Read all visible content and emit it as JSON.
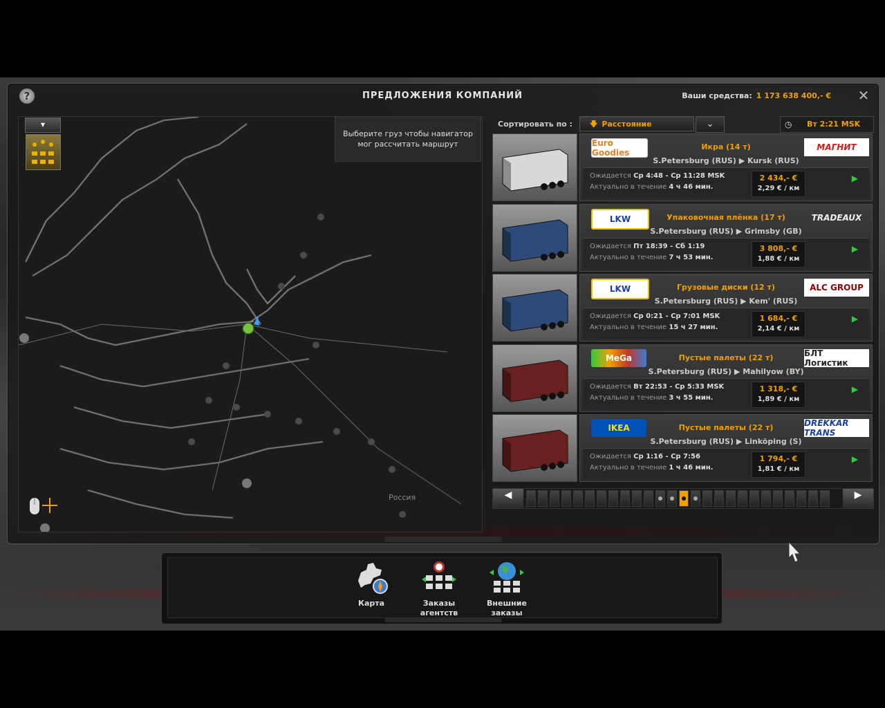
{
  "window": {
    "title": "ПРЕДЛОЖЕНИЯ КОМПАНИЙ",
    "funds_label": "Ваши средства:",
    "funds_value": "1 173 638 400,- €",
    "help_icon": "question-icon",
    "close_icon": "close-icon"
  },
  "map": {
    "tooltip_line1": "Выберите груз чтобы навигатор",
    "tooltip_line2": "мог рассчитать маршрут",
    "region_label": "Россия"
  },
  "sort": {
    "label": "Сортировать по :",
    "selected": "Расстояние",
    "game_time": "Вт 2:21 MSK"
  },
  "jobs": [
    {
      "company_left": "Euro Goodies",
      "company_right": "МАГНИТ",
      "cargo": "Икра (14 т)",
      "from": "S.Petersburg (RUS)",
      "to": "Kursk (RUS)",
      "expected_label": "Ожидается",
      "expected": "Ср 4:48 - Ср 11:28 MSK",
      "valid_label": "Актуально в течение",
      "valid": "4 ч 46 мин.",
      "price": "2 434,- €",
      "rate": "2,29 € / км",
      "trailer_color": "#d8d8d8"
    },
    {
      "company_left": "LKW",
      "company_right": "TRADEAUX",
      "cargo": "Упаковочная плёнка (17 т)",
      "from": "S.Petersburg (RUS)",
      "to": "Grimsby (GB)",
      "expected_label": "Ожидается",
      "expected": "Пт 18:39 - Сб 1:19",
      "valid_label": "Актуально в течение",
      "valid": "7 ч 53 мин.",
      "price": "3 808,- €",
      "rate": "1,88 € / км",
      "trailer_color": "#2d4a78"
    },
    {
      "company_left": "LKW",
      "company_right": "ALC GROUP",
      "cargo": "Грузовые диски (12 т)",
      "from": "S.Petersburg (RUS)",
      "to": "Kem' (RUS)",
      "expected_label": "Ожидается",
      "expected": "Ср 0:21 - Ср 7:01 MSK",
      "valid_label": "Актуально в течение",
      "valid": "15 ч 27 мин.",
      "price": "1 684,- €",
      "rate": "2,14 € / км",
      "trailer_color": "#2d4a78"
    },
    {
      "company_left": "MeGa",
      "company_right": "БЛТ Логистик",
      "cargo": "Пустые палеты (22 т)",
      "from": "S.Petersburg (RUS)",
      "to": "Mahilyow (BY)",
      "expected_label": "Ожидается",
      "expected": "Вт 22:53 - Ср 5:33 MSK",
      "valid_label": "Актуально в течение",
      "valid": "3 ч 55 мин.",
      "price": "1 318,- €",
      "rate": "1,89 € / км",
      "trailer_color": "#6a2020"
    },
    {
      "company_left": "IKEA",
      "company_right": "DREKKAR TRANS",
      "cargo": "Пустые палеты (22 т)",
      "from": "S.Petersburg (RUS)",
      "to": "Linköping (S)",
      "expected_label": "Ожидается",
      "expected": "Ср 1:16 - Ср 7:56",
      "valid_label": "Актуально в течение",
      "valid": "1 ч 46 мин.",
      "price": "1 794,- €",
      "rate": "1,81 € / км",
      "trailer_color": "#6a2020"
    }
  ],
  "dock": {
    "map": "Карта",
    "agency_line1": "Заказы",
    "agency_line2": "агентств",
    "external_line1": "Внешние",
    "external_line2": "заказы"
  },
  "colors": {
    "accent": "#f0a000",
    "play": "#2ecc40"
  }
}
